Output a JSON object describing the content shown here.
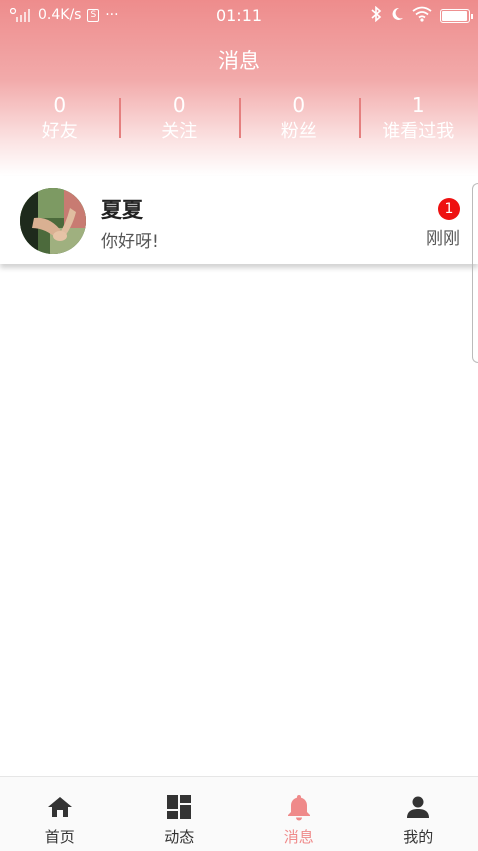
{
  "status_bar": {
    "net_speed": "0.4K/s",
    "s_icon": "S",
    "more": "···",
    "time": "01:11",
    "battery_level": 0.95
  },
  "header": {
    "title": "消息",
    "stats": [
      {
        "value": "0",
        "label": "好友"
      },
      {
        "value": "0",
        "label": "关注"
      },
      {
        "value": "0",
        "label": "粉丝"
      },
      {
        "value": "1",
        "label": "谁看过我"
      }
    ]
  },
  "messages": [
    {
      "name": "夏夏",
      "preview": "你好呀!",
      "time": "刚刚",
      "unread": "1"
    }
  ],
  "tabs": [
    {
      "label": "首页",
      "icon": "home-icon"
    },
    {
      "label": "动态",
      "icon": "dashboard-icon"
    },
    {
      "label": "消息",
      "icon": "bell-icon"
    },
    {
      "label": "我的",
      "icon": "person-icon"
    }
  ],
  "colors": {
    "accent": "#ef8a8a",
    "badge": "#ee1111",
    "header_top": "#ee8c8c"
  }
}
